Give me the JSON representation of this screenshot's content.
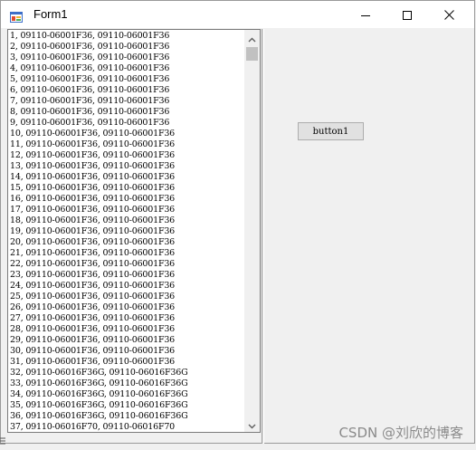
{
  "window": {
    "title": "Form1",
    "icon": "winforms-app-icon"
  },
  "titlebar_buttons": {
    "minimize": "minimize-icon",
    "maximize": "maximize-icon",
    "close": "close-icon"
  },
  "listbox": {
    "items": [
      "1, 09110-06001F36, 09110-06001F36",
      "2, 09110-06001F36, 09110-06001F36",
      "3, 09110-06001F36, 09110-06001F36",
      "4, 09110-06001F36, 09110-06001F36",
      "5, 09110-06001F36, 09110-06001F36",
      "6, 09110-06001F36, 09110-06001F36",
      "7, 09110-06001F36, 09110-06001F36",
      "8, 09110-06001F36, 09110-06001F36",
      "9, 09110-06001F36, 09110-06001F36",
      "10, 09110-06001F36, 09110-06001F36",
      "11, 09110-06001F36, 09110-06001F36",
      "12, 09110-06001F36, 09110-06001F36",
      "13, 09110-06001F36, 09110-06001F36",
      "14, 09110-06001F36, 09110-06001F36",
      "15, 09110-06001F36, 09110-06001F36",
      "16, 09110-06001F36, 09110-06001F36",
      "17, 09110-06001F36, 09110-06001F36",
      "18, 09110-06001F36, 09110-06001F36",
      "19, 09110-06001F36, 09110-06001F36",
      "20, 09110-06001F36, 09110-06001F36",
      "21, 09110-06001F36, 09110-06001F36",
      "22, 09110-06001F36, 09110-06001F36",
      "23, 09110-06001F36, 09110-06001F36",
      "24, 09110-06001F36, 09110-06001F36",
      "25, 09110-06001F36, 09110-06001F36",
      "26, 09110-06001F36, 09110-06001F36",
      "27, 09110-06001F36, 09110-06001F36",
      "28, 09110-06001F36, 09110-06001F36",
      "29, 09110-06001F36, 09110-06001F36",
      "30, 09110-06001F36, 09110-06001F36",
      "31, 09110-06001F36, 09110-06001F36",
      "32, 09110-06016F36G, 09110-06016F36G",
      "33, 09110-06016F36G, 09110-06016F36G",
      "34, 09110-06016F36G, 09110-06016F36G",
      "35, 09110-06016F36G, 09110-06016F36G",
      "36, 09110-06016F36G, 09110-06016F36G",
      "37, 09110-06016F70, 09110-06016F70"
    ],
    "scroll_up_icon": "chevron-up-icon",
    "scroll_down_icon": "chevron-down-icon"
  },
  "button1": {
    "label": "button1"
  },
  "watermark": {
    "text": "CSDN @刘欣的博客"
  }
}
